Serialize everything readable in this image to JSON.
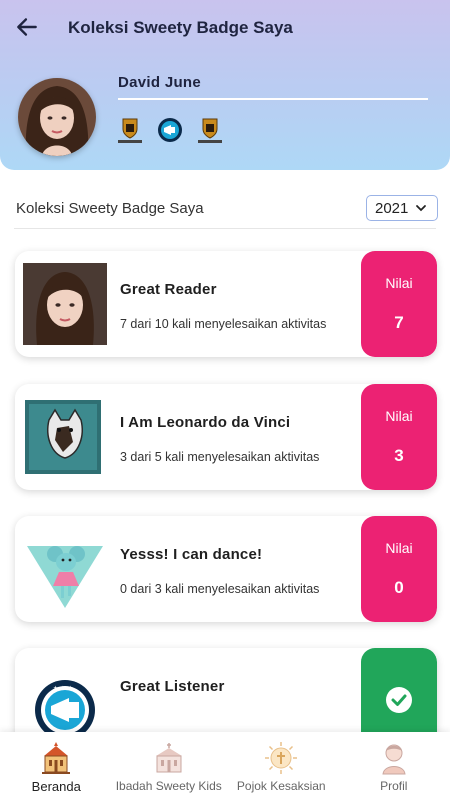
{
  "header": {
    "title": "Koleksi Sweety Badge Saya",
    "back_icon": "arrow-left-icon"
  },
  "profile": {
    "name": "David June",
    "mini_badges": [
      {
        "icon": "porsche-crest-icon",
        "caption": "JASCI"
      },
      {
        "icon": "megaphone-badge-icon",
        "caption": ""
      },
      {
        "icon": "porsche-crest-icon",
        "caption": "JASCI"
      }
    ]
  },
  "collection": {
    "section_title": "Koleksi Sweety Badge Saya",
    "year": "2021",
    "score_label": "Nilai"
  },
  "badges": [
    {
      "name": "Great Reader",
      "progress": "7 dari 10 kali menyelesaikan aktivitas",
      "score": "7",
      "color": "#ec2273"
    },
    {
      "name": "I Am Leonardo da Vinci",
      "progress": "3 dari 5 kali menyelesaikan aktivitas",
      "score": "3",
      "color": "#ec2273"
    },
    {
      "name": "Yesss! I can dance!",
      "progress": "0 dari 3 kali menyelesaikan aktivitas",
      "score": "0",
      "color": "#ec2273"
    },
    {
      "name": "Great Listener",
      "progress": "",
      "score": "",
      "completed": true,
      "color": "#21a65a"
    }
  ],
  "bottom_nav": [
    {
      "label": "Beranda",
      "icon": "church-icon",
      "active": true
    },
    {
      "label": "Ibadah Sweety Kids",
      "icon": "church-building-icon",
      "active": false
    },
    {
      "label": "Pojok Kesaksian",
      "icon": "sun-cross-icon",
      "active": false
    },
    {
      "label": "Profil",
      "icon": "child-avatar-icon",
      "active": false
    }
  ]
}
